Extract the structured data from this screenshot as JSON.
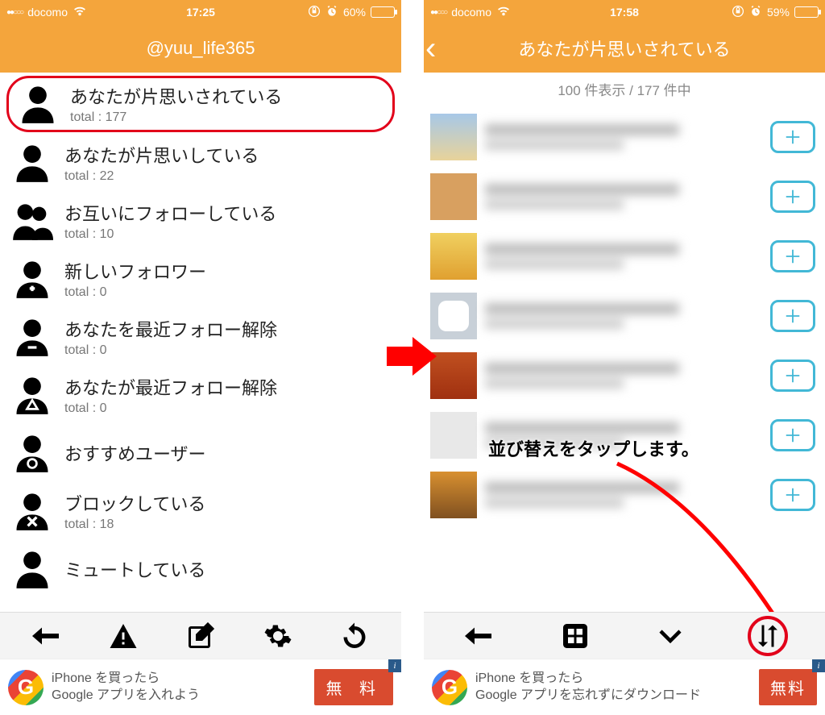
{
  "left": {
    "status": {
      "carrier": "docomo",
      "time": "17:25",
      "battery_pct": "60%",
      "signal_dots": "●●○○○"
    },
    "nav": {
      "title": "@yuu_life365"
    },
    "menu": [
      {
        "title": "あなたが片思いされている",
        "sub": "total : 177",
        "icon": "person-left",
        "highlight": true
      },
      {
        "title": "あなたが片思いしている",
        "sub": "total : 22",
        "icon": "person-right"
      },
      {
        "title": "お互いにフォローしている",
        "sub": "total : 10",
        "icon": "people"
      },
      {
        "title": "新しいフォロワー",
        "sub": "total : 0",
        "icon": "person-plus"
      },
      {
        "title": "あなたを最近フォロー解除",
        "sub": "total : 0",
        "icon": "person-minus"
      },
      {
        "title": "あなたが最近フォロー解除",
        "sub": "total : 0",
        "icon": "person-triangle"
      },
      {
        "title": "おすすめユーザー",
        "sub": "",
        "icon": "person-circle"
      },
      {
        "title": "ブロックしている",
        "sub": "total : 18",
        "icon": "person-x"
      },
      {
        "title": "ミュートしている",
        "sub": "",
        "icon": "person-mute"
      }
    ],
    "toolbar": [
      "back",
      "warning",
      "compose",
      "settings",
      "refresh"
    ],
    "ad": {
      "line1": "iPhone を買ったら",
      "line2": "Google アプリを入れよう",
      "button": "無 料"
    }
  },
  "right": {
    "status": {
      "carrier": "docomo",
      "time": "17:58",
      "battery_pct": "59%",
      "signal_dots": "●●○○○"
    },
    "nav": {
      "title": "あなたが片思いされている"
    },
    "count": "100 件表示 / 177 件中",
    "toolbar": [
      "back",
      "grid",
      "chevron-down",
      "sort"
    ],
    "annotation": "並び替えをタップします。",
    "ad": {
      "line1": "iPhone を買ったら",
      "line2": "Google アプリを忘れずにダウンロード",
      "button": "無料"
    }
  }
}
